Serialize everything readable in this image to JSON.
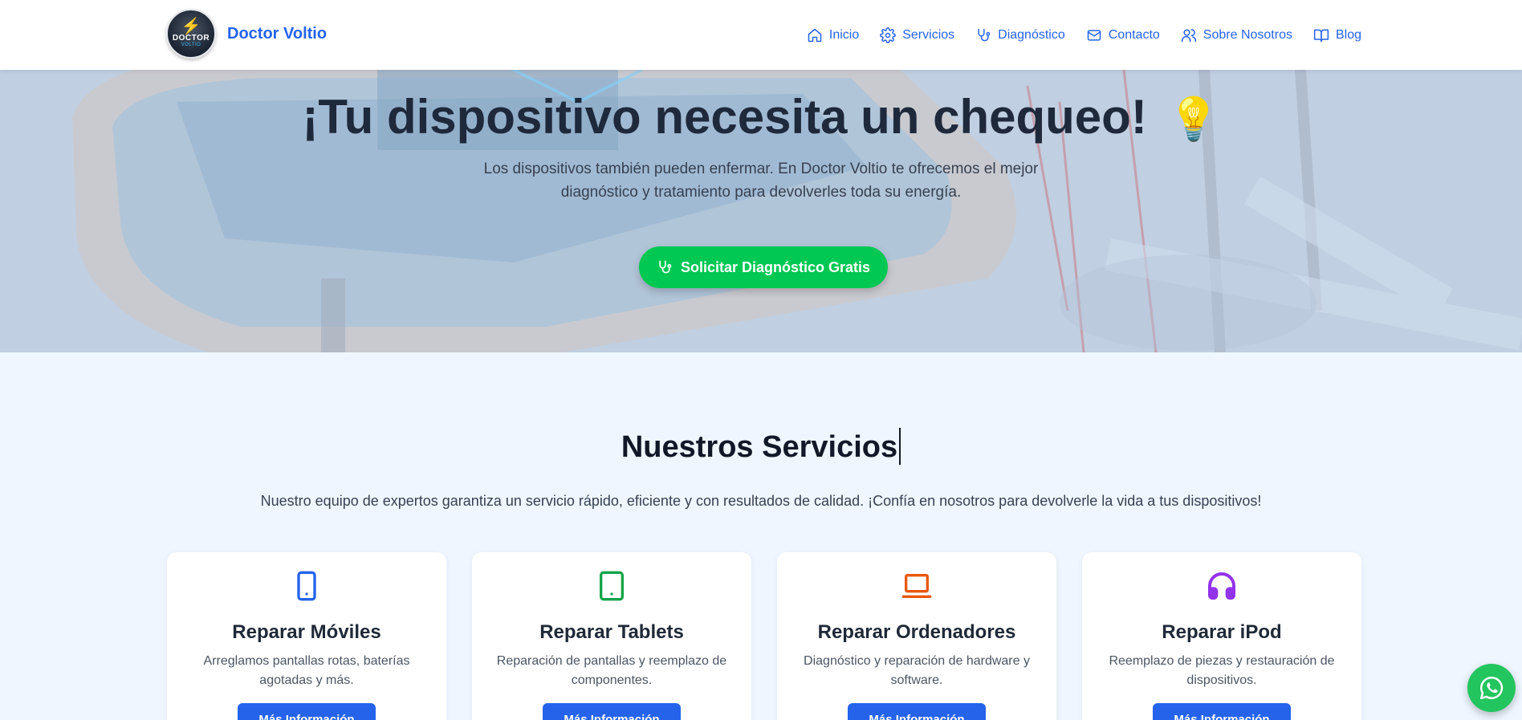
{
  "brand": {
    "name": "Doctor Voltio",
    "logo_line1": "DOCTOR",
    "logo_line2": "VOLTIO"
  },
  "nav": [
    {
      "label": "Inicio",
      "icon": "home-icon"
    },
    {
      "label": "Servicios",
      "icon": "gear-icon"
    },
    {
      "label": "Diagnóstico",
      "icon": "stethoscope-icon"
    },
    {
      "label": "Contacto",
      "icon": "mail-icon"
    },
    {
      "label": "Sobre Nosotros",
      "icon": "users-icon"
    },
    {
      "label": "Blog",
      "icon": "book-icon"
    }
  ],
  "hero": {
    "title": "¡Tu dispositivo necesita un chequeo!",
    "title_emoji": "💡",
    "subtitle": "Los dispositivos también pueden enfermar. En Doctor Voltio te ofrecemos el mejor diagnóstico y tratamiento para devolverles toda su energía.",
    "cta_label": "Solicitar Diagnóstico Gratis"
  },
  "services": {
    "title": "Nuestros Servicios",
    "description": "Nuestro equipo de expertos garantiza un servicio rápido, eficiente y con resultados de calidad. ¡Confía en nosotros para devolverle la vida a tus dispositivos!",
    "cards": [
      {
        "title": "Reparar Móviles",
        "desc": "Arreglamos pantallas rotas, baterías agotadas y más.",
        "button": "Más Información",
        "icon": "smartphone-icon",
        "color": "#2563eb"
      },
      {
        "title": "Reparar Tablets",
        "desc": "Reparación de pantallas y reemplazo de componentes.",
        "button": "Más Información",
        "icon": "tablet-icon",
        "color": "#16a34a"
      },
      {
        "title": "Reparar Ordenadores",
        "desc": "Diagnóstico y reparación de hardware y software.",
        "button": "Más Información",
        "icon": "laptop-icon",
        "color": "#ea580c"
      },
      {
        "title": "Reparar iPod",
        "desc": "Reemplazo de piezas y restauración de dispositivos.",
        "button": "Más Información",
        "icon": "headphones-icon",
        "color": "#9333ea"
      }
    ]
  },
  "whatsapp": {
    "icon": "whatsapp-icon",
    "color": "#22c55e"
  }
}
